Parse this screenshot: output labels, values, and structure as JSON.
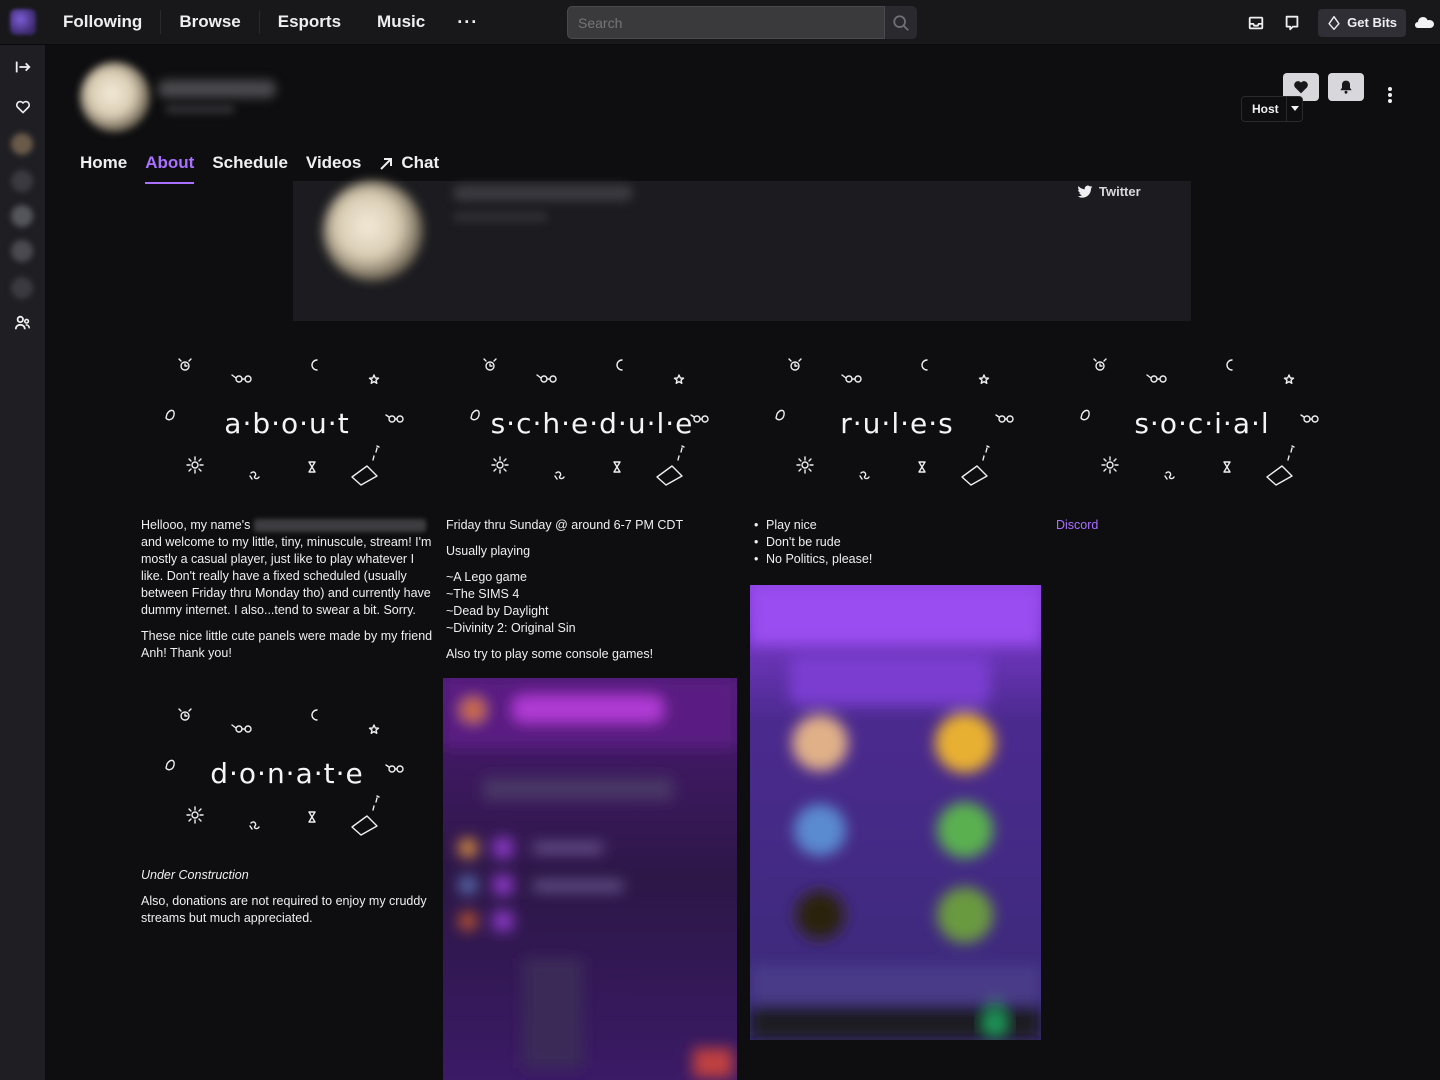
{
  "topnav": {
    "links": [
      "Following",
      "Browse",
      "Esports",
      "Music"
    ],
    "more_label": "···",
    "search_placeholder": "Search",
    "get_bits_label": "Get Bits"
  },
  "channel": {
    "follow_icon": "heart-icon",
    "notify_icon": "bell-icon",
    "host_label": "Host"
  },
  "tabs": [
    {
      "label": "Home",
      "active": false
    },
    {
      "label": "About",
      "active": true
    },
    {
      "label": "Schedule",
      "active": false
    },
    {
      "label": "Videos",
      "active": false
    },
    {
      "label": "Chat",
      "active": false,
      "icon": "external-arrow-icon"
    }
  ],
  "banner": {
    "twitter_label": "Twitter"
  },
  "panels": {
    "about": {
      "title": "a·b·o·u·t",
      "intro_prefix": "Hellooo, my name's",
      "intro_rest": "and welcome to my little, tiny, minuscule, stream! I'm mostly a casual player, just like to play whatever I like. Don't really have a fixed scheduled (usually between Friday thru Monday tho) and currently have dummy internet. I also...tend to swear a bit. Sorry.",
      "credit": "These nice little cute panels were made by my friend Anh! Thank you!"
    },
    "schedule": {
      "title": "s·c·h·e·d·u·l·e",
      "when": "Friday thru Sunday @ around 6-7 PM CDT",
      "playing_label": "Usually playing",
      "games": [
        "~A Lego game",
        "~The SIMS 4",
        "~Dead by Daylight",
        "~Divinity 2: Original Sin"
      ],
      "console_note": "Also try to play some console games!"
    },
    "rules": {
      "title": "r·u·l·e·s",
      "items": [
        "Play nice",
        "Don't be rude",
        "No Politics, please!"
      ]
    },
    "social": {
      "title": "s·o·c·i·a·l",
      "discord_label": "Discord"
    },
    "donate": {
      "title": "d·o·n·a·t·e",
      "status": "Under Construction",
      "note": "Also, donations are not required to enjoy my cruddy streams but much appreciated."
    }
  },
  "colors": {
    "accent": "#a970ff",
    "bg": "#0e0e10",
    "nav_bg": "#18181b",
    "sidenav_bg": "#1f1f23"
  }
}
